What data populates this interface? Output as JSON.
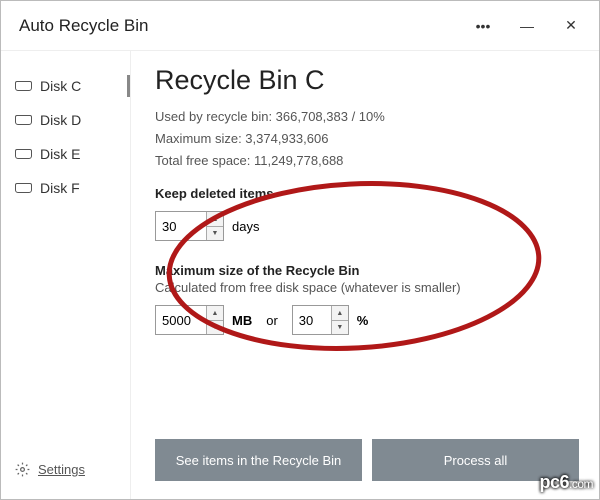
{
  "titlebar": {
    "app_title": "Auto Recycle Bin",
    "more": "•••",
    "min": "—",
    "close": "✕"
  },
  "sidebar": {
    "items": [
      {
        "label": "Disk C",
        "active": true
      },
      {
        "label": "Disk D",
        "active": false
      },
      {
        "label": "Disk E",
        "active": false
      },
      {
        "label": "Disk F",
        "active": false
      }
    ],
    "settings_label": "Settings"
  },
  "main": {
    "heading": "Recycle Bin C",
    "used_label": "Used by recycle bin: 366,708,383 / 10%",
    "max_label": "Maximum size: 3,374,933,606",
    "free_label": "Total free space: 11,249,778,688",
    "keep_label": "Keep deleted items",
    "keep_value": "30",
    "keep_unit": "days",
    "maxsize_label": "Maximum size of the Recycle Bin",
    "maxsize_sub": "Calculated from free disk space (whatever is smaller)",
    "mb_value": "5000",
    "mb_unit": "MB",
    "or_label": "or",
    "pct_value": "30",
    "pct_unit": "%",
    "see_items": "See items in the Recycle Bin",
    "process_all": "Process all"
  },
  "watermark": {
    "brand": "pc6",
    "suffix": ".com"
  }
}
